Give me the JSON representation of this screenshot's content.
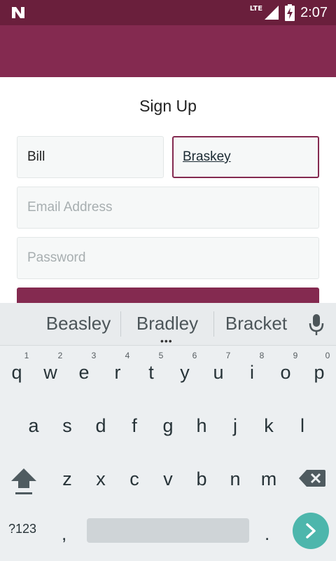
{
  "status_bar": {
    "time": "2:07",
    "network": "LTE",
    "icons": [
      "notification-n-icon",
      "signal-icon",
      "battery-charging-icon"
    ]
  },
  "form": {
    "title": "Sign Up",
    "first_name_value": "Bill",
    "last_name_value": "Braskey",
    "email_placeholder": "Email Address",
    "password_placeholder": "Password"
  },
  "keyboard": {
    "suggestions": [
      "Beasley",
      "Bradley",
      "Bracket"
    ],
    "row1": [
      "q",
      "w",
      "e",
      "r",
      "t",
      "y",
      "u",
      "i",
      "o",
      "p"
    ],
    "row1_hints": [
      "1",
      "2",
      "3",
      "4",
      "5",
      "6",
      "7",
      "8",
      "9",
      "0"
    ],
    "row2": [
      "a",
      "s",
      "d",
      "f",
      "g",
      "h",
      "j",
      "k",
      "l"
    ],
    "row3": [
      "z",
      "x",
      "c",
      "v",
      "b",
      "n",
      "m"
    ],
    "symbols_label": "?123",
    "comma": ",",
    "period": "."
  },
  "colors": {
    "status_bar": "#6a1f3c",
    "app_bar": "#842a50",
    "accent": "#842a50",
    "enter_key": "#4db6ac"
  }
}
